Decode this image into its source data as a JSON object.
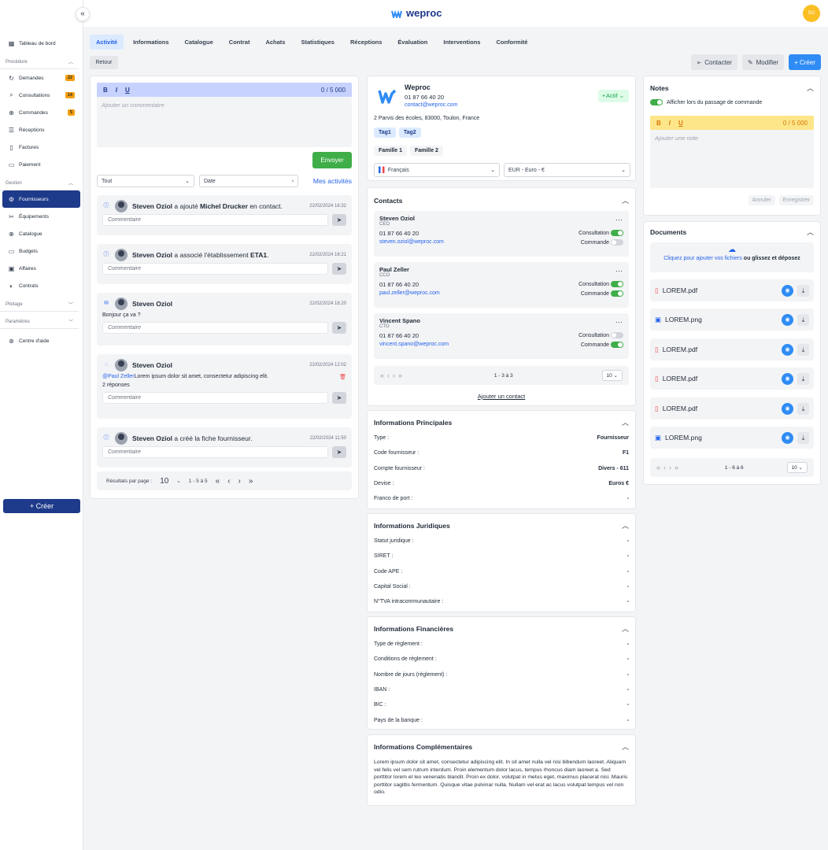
{
  "sidebar": {
    "dashboard": "Tableau de bord",
    "procedure_section": "Procédure",
    "procedure": [
      {
        "icon": "refresh-icon",
        "label": "Demandes",
        "badge": "22"
      },
      {
        "icon": "search-icon",
        "label": "Consultations",
        "badge": "14"
      },
      {
        "icon": "cart-icon",
        "label": "Commandes",
        "badge": "5"
      },
      {
        "icon": "list-icon",
        "label": "Réceptions",
        "badge": ""
      },
      {
        "icon": "file-icon",
        "label": "Factures",
        "badge": ""
      },
      {
        "icon": "card-icon",
        "label": "Paiement",
        "badge": ""
      }
    ],
    "gestion_section": "Gestion",
    "gestion": [
      {
        "icon": "gear-icon",
        "label": "Fournisseurs",
        "active": true
      },
      {
        "icon": "tools-icon",
        "label": "Équipements"
      },
      {
        "icon": "cart-icon",
        "label": "Catalogue"
      },
      {
        "icon": "folder-icon",
        "label": "Budgets"
      },
      {
        "icon": "briefcase-icon",
        "label": "Affaires"
      },
      {
        "icon": "contract-icon",
        "label": "Contrats"
      }
    ],
    "pilotage_section": "Pilotage",
    "parametres_section": "Paramètres",
    "help": "Centre d'aide",
    "create": "+ Créer"
  },
  "header": {
    "brand": "weproc",
    "avatar": "SO"
  },
  "tabs": [
    "Activité",
    "Informations",
    "Catalogue",
    "Contrat",
    "Achats",
    "Statistiques",
    "Réceptions",
    "Évaluation",
    "Interventions",
    "Conformité"
  ],
  "toolbar": {
    "back": "Retour",
    "contact": "Contacter",
    "edit": "Modifier",
    "create": "+ Créer"
  },
  "activity": {
    "counter": "0 / 5 000",
    "placeholder": "Ajouter un commentaire",
    "send": "Envoyer",
    "filter_all": "Tout",
    "filter_date": "Date",
    "my_activities": "Mes activités",
    "comment_placeholder": "Commentaire",
    "items": [
      {
        "author": "Steven Oziol",
        "pre": " a ajouté ",
        "bold": "Michel Drucker",
        "post": " en contact.",
        "date": "22/02/2024 16:32"
      },
      {
        "author": "Steven Oziol",
        "pre": " a associé l'établissement ",
        "bold": "ETA1",
        "post": ".",
        "date": "22/02/2024 16:21"
      },
      {
        "author": "Steven Oziol",
        "date": "22/02/2024 16:20",
        "body": "Bonjour ça va ?"
      },
      {
        "author": "Steven Oziol",
        "date": "22/02/2024 12:02",
        "mention": "@Paul Zeller",
        "body": " Lorem ipsum dolor sit amet, consectetur adipiscing elit.",
        "replies": "2 réponses"
      },
      {
        "author": "Steven Oziol",
        "pre": " a créé la fiche fournisseur.",
        "date": "22/02/2024 11:50"
      }
    ],
    "pager": {
      "label": "Résultats par page :",
      "size": "10",
      "range": "1 - 5 à 5"
    }
  },
  "supplier": {
    "name": "Weproc",
    "phone": "01 87 66 40 20",
    "email": "contact@weproc.com",
    "status": "• Actif",
    "address": "2 Parvis des écoles, 83000, Toulon, France",
    "tags": [
      "Tag1",
      "Tag2"
    ],
    "families": [
      "Famille 1",
      "Famille 2"
    ],
    "language": "Français",
    "currency": "EUR - Euro - €"
  },
  "contacts": {
    "title": "Contacts",
    "consultation": "Consultation",
    "commande": "Commande",
    "list": [
      {
        "name": "Steven Oziol",
        "role": "CEO",
        "phone": "01 87 66 40 20",
        "email": "steven.oziol@weproc.com",
        "consult": true,
        "cmd": false
      },
      {
        "name": "Paul Zeller",
        "role": "CCO",
        "phone": "01 87 66 40 20",
        "email": "paul.zeller@weproc.com",
        "consult": true,
        "cmd": true
      },
      {
        "name": "Vincent Spano",
        "role": "CTO",
        "phone": "01 87 66 40 20",
        "email": "vincent.spano@weproc.com",
        "consult": false,
        "cmd": true
      }
    ],
    "range": "1 - 3 à 3",
    "size": "10",
    "add": "Ajouter un contact"
  },
  "info_principales": {
    "title": "Informations Principales",
    "rows": [
      [
        "Type :",
        "Fournisseur"
      ],
      [
        "Code fournisseur :",
        "F1"
      ],
      [
        "Compte fournisseur :",
        "Divers - 611"
      ],
      [
        "Devise :",
        "Euros €"
      ],
      [
        "Franco de port :",
        "-"
      ]
    ]
  },
  "info_juridiques": {
    "title": "Informations Juridiques",
    "rows": [
      [
        "Statut juridique :",
        "-"
      ],
      [
        "SIRET :",
        "-"
      ],
      [
        "Code APE :",
        "-"
      ],
      [
        "Capital Social :",
        "-"
      ],
      [
        "N°TVA intracommunautaire :",
        "-"
      ]
    ]
  },
  "info_financieres": {
    "title": "Informations Financières",
    "rows": [
      [
        "Type de règlement :",
        "-"
      ],
      [
        "Conditions de règlement :",
        "-"
      ],
      [
        "Nombre de jours (règlement) :",
        "-"
      ],
      [
        "IBAN :",
        "-"
      ],
      [
        "BIC :",
        "-"
      ],
      [
        "Pays de la banque :",
        "-"
      ]
    ]
  },
  "info_complementaires": {
    "title": "Informations Complémentaires",
    "text": "Lorem ipsum dolor sit amet, consectetur adipiscing elit. In sit amet nulla vel nisi bibendum laoreet. Aliquam vel felis vel sem rutrum interdum. Proin elementum dolor lacus, tempus rhoncus diam laoreet a. Sed porttitor lorem et leo venenatis blandit. Proin ex dolor, volutpat in metus eget, maximus placerat nisi. Mauris porttitor sagittis fermentum. Quisque vitae pulvinar nulla. Nullam vel erat ac lacus volutpat tempus vel non odio."
  },
  "notes": {
    "title": "Notes",
    "toggle_label": "Afficher lors du passage de commande",
    "counter": "0 / 5 000",
    "placeholder": "Ajouter une note",
    "cancel": "Annuler",
    "save": "Enregistrer"
  },
  "documents": {
    "title": "Documents",
    "upload_link": "Cliquez pour ajouter vos fichiers",
    "upload_rest": " ou glissez et déposez",
    "files": [
      {
        "name": "LOREM.pdf",
        "type": "pdf"
      },
      {
        "name": "LOREM.png",
        "type": "png"
      },
      {
        "name": "LOREM.pdf",
        "type": "pdf"
      },
      {
        "name": "LOREM.pdf",
        "type": "pdf"
      },
      {
        "name": "LOREM.pdf",
        "type": "pdf"
      },
      {
        "name": "LOREM.png",
        "type": "png"
      }
    ],
    "range": "1 - 6 à 6",
    "size": "10"
  }
}
